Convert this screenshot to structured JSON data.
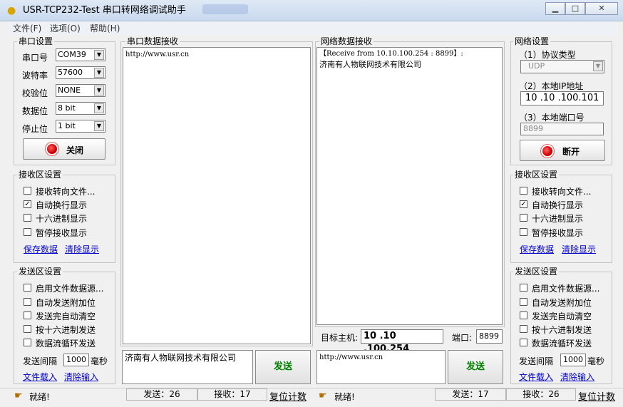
{
  "window": {
    "title": "USR-TCP232-Test 串口转网络调试助手",
    "minimize": "▁",
    "maximize": "□",
    "close": "✕"
  },
  "menu": [
    "文件(F)",
    "选项(O)",
    "帮助(H)"
  ],
  "serial_settings": {
    "legend": "串口设置",
    "port_label": "串口号",
    "port_value": "COM39",
    "baud_label": "波特率",
    "baud_value": "57600",
    "parity_label": "校验位",
    "parity_value": "NONE",
    "data_bits_label": "数据位",
    "data_bits_value": "8 bit",
    "stop_bits_label": "停止位",
    "stop_bits_value": "1 bit",
    "toggle_label": "关闭"
  },
  "left_receive": {
    "legend": "接收区设置",
    "options": [
      {
        "label": "接收转向文件...",
        "checked": false
      },
      {
        "label": "自动换行显示",
        "checked": true
      },
      {
        "label": "十六进制显示",
        "checked": false
      },
      {
        "label": "暂停接收显示",
        "checked": false
      }
    ],
    "save_link": "保存数据",
    "clear_link": "清除显示"
  },
  "left_send": {
    "legend": "发送区设置",
    "options": [
      {
        "label": "启用文件数据源...",
        "checked": false
      },
      {
        "label": "自动发送附加位",
        "checked": false
      },
      {
        "label": "发送完自动清空",
        "checked": false
      },
      {
        "label": "按十六进制发送",
        "checked": false
      },
      {
        "label": "数据流循环发送",
        "checked": false
      }
    ],
    "interval_label": "发送间隔",
    "interval_value": "1000",
    "interval_unit": "毫秒",
    "load_link": "文件载入",
    "clear_link": "清除输入"
  },
  "serial_receive": {
    "legend": "串口数据接收",
    "content": "http://www.usr.cn"
  },
  "network_receive": {
    "legend": "网络数据接收",
    "line1": "【Receive from 10.10.100.254 : 8899】:",
    "line2": "济南有人物联网技术有限公司"
  },
  "target": {
    "host_label": "目标主机:",
    "host_value": "10 .10 .100.254",
    "port_label": "端口:",
    "port_value": "8899"
  },
  "serial_send": {
    "content": "济南有人物联网技术有限公司",
    "send_label": "发送"
  },
  "network_send": {
    "content": "http://www.usr.cn",
    "send_label": "发送"
  },
  "net_settings": {
    "legend": "网络设置",
    "protocol_label": "（1）协议类型",
    "protocol_value": "UDP",
    "ip_label": "（2）本地IP地址",
    "ip_value": "10 .10 .100.101",
    "port_label": "（3）本地端口号",
    "port_value": "8899",
    "toggle_label": "断开"
  },
  "right_receive": {
    "legend": "接收区设置",
    "options": [
      {
        "label": "接收转向文件...",
        "checked": false
      },
      {
        "label": "自动换行显示",
        "checked": true
      },
      {
        "label": "十六进制显示",
        "checked": false
      },
      {
        "label": "暂停接收显示",
        "checked": false
      }
    ],
    "save_link": "保存数据",
    "clear_link": "清除显示"
  },
  "right_send": {
    "legend": "发送区设置",
    "options": [
      {
        "label": "启用文件数据源...",
        "checked": false
      },
      {
        "label": "自动发送附加位",
        "checked": false
      },
      {
        "label": "发送完自动清空",
        "checked": false
      },
      {
        "label": "按十六进制发送",
        "checked": false
      },
      {
        "label": "数据流循环发送",
        "checked": false
      }
    ],
    "interval_label": "发送间隔",
    "interval_value": "1000",
    "interval_unit": "毫秒",
    "load_link": "文件载入",
    "clear_link": "清除输入"
  },
  "status": {
    "left_ready": "就绪!",
    "left_sent": "发送：26",
    "left_recv": "接收：17",
    "left_reset": "复位计数",
    "right_ready": "就绪!",
    "right_sent": "发送：17",
    "right_recv": "接收：26",
    "right_reset": "复位计数"
  },
  "icons": {
    "app": "app-icon",
    "led": "red-led-icon",
    "ready": "hand-pointer-icon"
  }
}
